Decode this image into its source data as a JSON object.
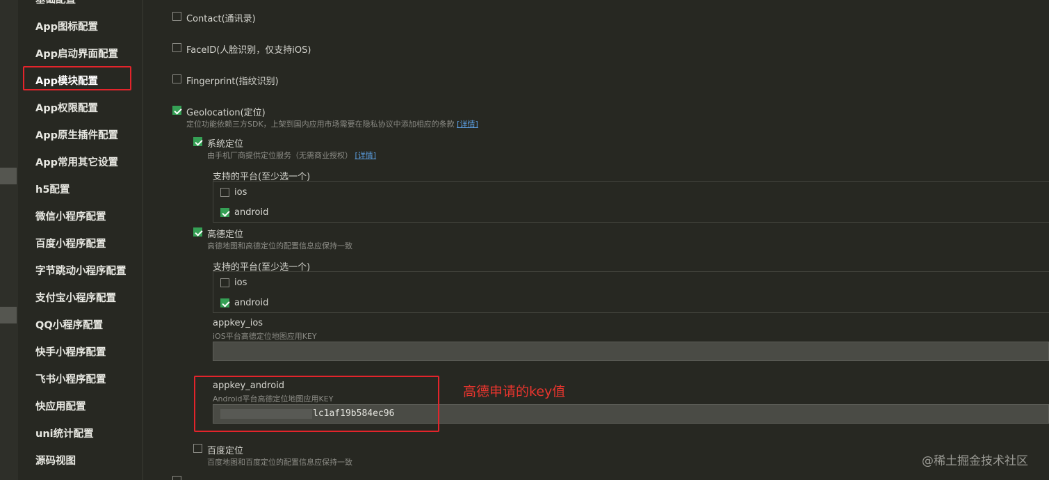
{
  "sidebar": {
    "items": [
      {
        "label": "基础配置"
      },
      {
        "label": "App图标配置"
      },
      {
        "label": "App启动界面配置"
      },
      {
        "label": "App模块配置"
      },
      {
        "label": "App权限配置"
      },
      {
        "label": "App原生插件配置"
      },
      {
        "label": "App常用其它设置"
      },
      {
        "label": "h5配置"
      },
      {
        "label": "微信小程序配置"
      },
      {
        "label": "百度小程序配置"
      },
      {
        "label": "字节跳动小程序配置"
      },
      {
        "label": "支付宝小程序配置"
      },
      {
        "label": "QQ小程序配置"
      },
      {
        "label": "快手小程序配置"
      },
      {
        "label": "飞书小程序配置"
      },
      {
        "label": "快应用配置"
      },
      {
        "label": "uni统计配置"
      },
      {
        "label": "源码视图"
      }
    ],
    "active": "App模块配置"
  },
  "modules": {
    "contact": {
      "label": "Contact(通讯录)",
      "checked": false
    },
    "faceid": {
      "label": "FaceID(人脸识别，仅支持iOS)",
      "checked": false
    },
    "fingerprint": {
      "label": "Fingerprint(指纹识别)",
      "checked": false
    },
    "geolocation": {
      "label": "Geolocation(定位)",
      "checked": true,
      "desc": "定位功能依赖三方SDK，上架到国内应用市场需要在隐私协议中添加相应的条款",
      "link": "[详情]"
    },
    "system_location": {
      "label": "系统定位",
      "checked": true,
      "desc": "由手机厂商提供定位服务（无需商业授权）",
      "link": "[详情]",
      "platforms_title": "支持的平台(至少选一个)",
      "ios": {
        "label": "ios",
        "checked": false
      },
      "android": {
        "label": "android",
        "checked": true
      }
    },
    "amap": {
      "label": "高德定位",
      "checked": true,
      "desc": "高德地图和高德定位的配置信息应保持一致",
      "platforms_title": "支持的平台(至少选一个)",
      "ios": {
        "label": "ios",
        "checked": false
      },
      "android": {
        "label": "android",
        "checked": true
      },
      "appkey_ios": {
        "label": "appkey_ios",
        "desc": "iOS平台高德定位地图应用KEY",
        "value": ""
      },
      "appkey_android": {
        "label": "appkey_android",
        "desc": "Android平台高德定位地图应用KEY",
        "value": "lc1af19b584ec96"
      }
    },
    "baidu": {
      "label": "百度定位",
      "checked": false,
      "desc": "百度地图和百度定位的配置信息应保持一致"
    }
  },
  "annotation": "高德申请的key值",
  "watermark": "@稀土掘金技术社区",
  "colors": {
    "accent_check": "#35a055",
    "highlight_box": "#e3242b",
    "link": "#5b9ddf"
  }
}
